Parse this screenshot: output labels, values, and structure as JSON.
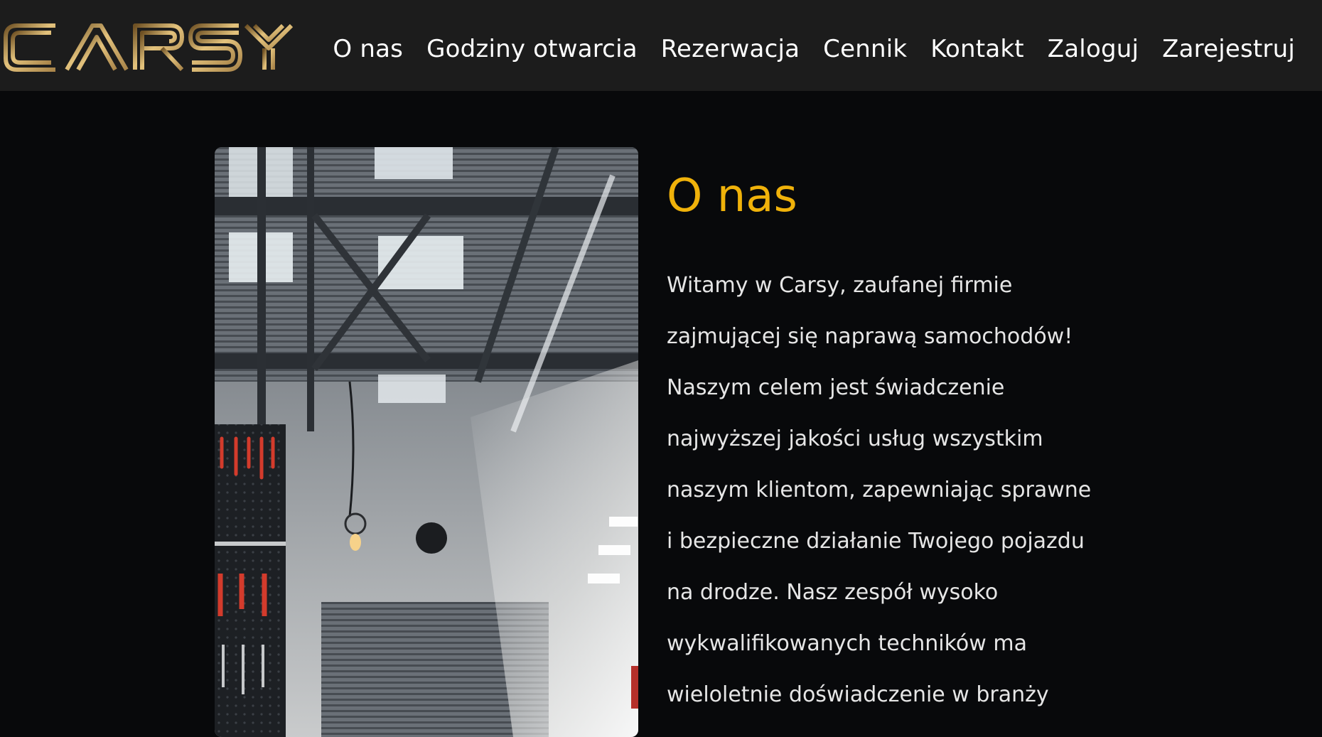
{
  "brand": {
    "logo_text": "CARSY",
    "accent_color": "#f0b20a",
    "logo_gradient": [
      "#7a5a26",
      "#e8c883",
      "#b08b4a"
    ]
  },
  "nav": {
    "items": [
      {
        "label": "O nas"
      },
      {
        "label": "Godziny otwarcia"
      },
      {
        "label": "Rezerwacja"
      },
      {
        "label": "Cennik"
      },
      {
        "label": "Kontakt"
      },
      {
        "label": "Zaloguj"
      },
      {
        "label": "Zarejestruj"
      }
    ]
  },
  "about": {
    "title": "O nas",
    "paragraph_lines": [
      "Witamy w Carsy, zaufanej firmie",
      "zajmującej się naprawą samochodów!",
      "Naszym celem jest świadczenie",
      "najwyższej jakości usług wszystkim",
      "naszym klientom, zapewniając sprawne",
      "i bezpieczne działanie Twojego pojazdu",
      "na drodze. Nasz zespół wysoko",
      "wykwalifikowanych techników ma",
      "wieloletnie doświadczenie w branży"
    ],
    "image_subject": "garage-workshop-photo"
  }
}
